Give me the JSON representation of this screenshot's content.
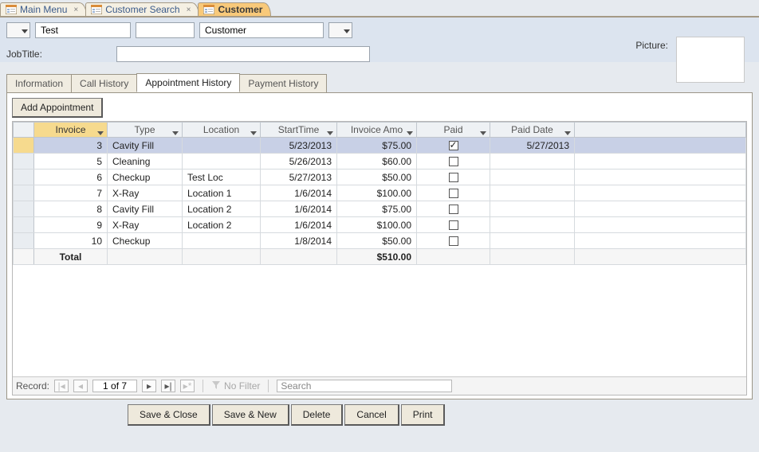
{
  "docTabs": [
    {
      "label": "Main Menu",
      "active": false
    },
    {
      "label": "Customer Search",
      "active": false
    },
    {
      "label": "Customer",
      "active": true
    }
  ],
  "header": {
    "firstName": "Test",
    "lastName": "Customer",
    "pictureLabel": "Picture:",
    "jobTitleLabel": "JobTitle:",
    "jobTitleValue": ""
  },
  "subTabs": [
    {
      "label": "Information",
      "active": false
    },
    {
      "label": "Call History",
      "active": false
    },
    {
      "label": "Appointment History",
      "active": true
    },
    {
      "label": "Payment History",
      "active": false
    }
  ],
  "addLabel": "Add Appointment",
  "columns": {
    "invoice": "Invoice",
    "type": "Type",
    "location": "Location",
    "start": "StartTime",
    "amount": "Invoice Amo",
    "paid": "Paid",
    "paidDate": "Paid Date"
  },
  "rows": [
    {
      "invoice": "3",
      "type": "Cavity Fill",
      "location": "",
      "start": "5/23/2013",
      "amount": "$75.00",
      "paid": true,
      "paidDate": "5/27/2013",
      "selected": true
    },
    {
      "invoice": "5",
      "type": "Cleaning",
      "location": "",
      "start": "5/26/2013",
      "amount": "$60.00",
      "paid": false,
      "paidDate": ""
    },
    {
      "invoice": "6",
      "type": "Checkup",
      "location": "Test Loc",
      "start": "5/27/2013",
      "amount": "$50.00",
      "paid": false,
      "paidDate": ""
    },
    {
      "invoice": "7",
      "type": "X-Ray",
      "location": "Location 1",
      "start": "1/6/2014",
      "amount": "$100.00",
      "paid": false,
      "paidDate": ""
    },
    {
      "invoice": "8",
      "type": "Cavity Fill",
      "location": "Location 2",
      "start": "1/6/2014",
      "amount": "$75.00",
      "paid": false,
      "paidDate": ""
    },
    {
      "invoice": "9",
      "type": "X-Ray",
      "location": "Location 2",
      "start": "1/6/2014",
      "amount": "$100.00",
      "paid": false,
      "paidDate": ""
    },
    {
      "invoice": "10",
      "type": "Checkup",
      "location": "",
      "start": "1/8/2014",
      "amount": "$50.00",
      "paid": false,
      "paidDate": ""
    }
  ],
  "totalRow": {
    "label": "Total",
    "amount": "$510.00"
  },
  "recordNav": {
    "label": "Record:",
    "position": "1 of 7",
    "noFilter": "No Filter",
    "searchPlaceholder": "Search"
  },
  "buttons": {
    "saveClose": "Save & Close",
    "saveNew": "Save & New",
    "delete": "Delete",
    "cancel": "Cancel",
    "print": "Print"
  }
}
